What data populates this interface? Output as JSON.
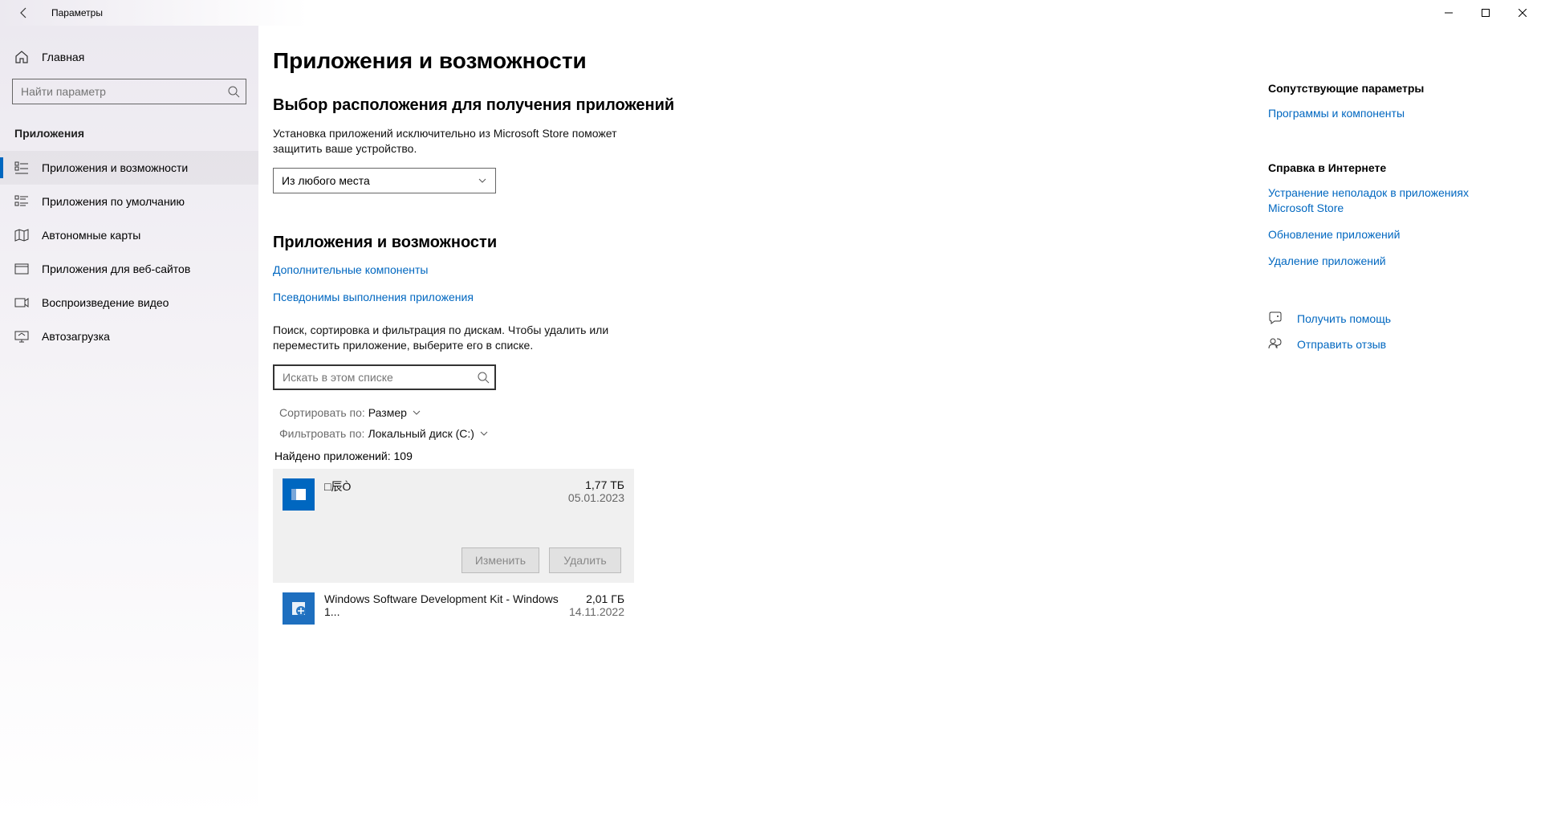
{
  "window": {
    "title": "Параметры"
  },
  "sidebar": {
    "home": "Главная",
    "search_placeholder": "Найти параметр",
    "section": "Приложения",
    "items": [
      {
        "label": "Приложения и возможности",
        "active": true
      },
      {
        "label": "Приложения по умолчанию"
      },
      {
        "label": "Автономные карты"
      },
      {
        "label": "Приложения для веб-сайтов"
      },
      {
        "label": "Воспроизведение видео"
      },
      {
        "label": "Автозагрузка"
      }
    ]
  },
  "page": {
    "title": "Приложения и возможности",
    "source_heading": "Выбор расположения для получения приложений",
    "source_desc": "Установка приложений исключительно из Microsoft Store поможет защитить ваше устройство.",
    "source_value": "Из любого места",
    "apps_heading": "Приложения и возможности",
    "link_optional": "Дополнительные компоненты",
    "link_aliases": "Псевдонимы выполнения приложения",
    "filter_desc": "Поиск, сортировка и фильтрация по дискам. Чтобы удалить или переместить приложение, выберите его в списке.",
    "app_search_placeholder": "Искать в этом списке",
    "sort_label": "Сортировать по:",
    "sort_value": "Размер",
    "filter_label": "Фильтровать по:",
    "filter_value": "Локальный диск (C:)",
    "found_label": "Найдено приложений: 109",
    "modify_btn": "Изменить",
    "uninstall_btn": "Удалить",
    "apps": [
      {
        "name": "□辰Ò",
        "size": "1,77 ТБ",
        "date": "05.01.2023",
        "selected": true
      },
      {
        "name": "Windows Software Development Kit - Windows 1...",
        "size": "2,01 ГБ",
        "date": "14.11.2022"
      }
    ]
  },
  "right": {
    "related_heading": "Сопутствующие параметры",
    "related_link": "Программы и компоненты",
    "help_heading": "Справка в Интернете",
    "help_links": [
      "Устранение неполадок в приложениях Microsoft Store",
      "Обновление приложений",
      "Удаление приложений"
    ],
    "get_help": "Получить помощь",
    "feedback": "Отправить отзыв"
  }
}
